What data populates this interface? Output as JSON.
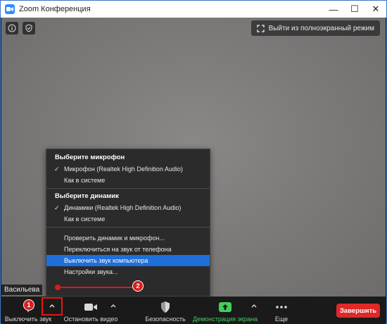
{
  "window": {
    "title": "Zoom Конференция",
    "minimize": "—",
    "maximize": "☐",
    "close": "✕"
  },
  "video": {
    "fullscreen_label": "Выйти из полноэкранный режим",
    "participant_name": "Васильева"
  },
  "audio_menu": {
    "mic_header": "Выберите микрофон",
    "mic_items": [
      {
        "label": "Микрофон (Realtek High Definition Audio)",
        "checked": true
      },
      {
        "label": "Как в системе",
        "checked": false
      }
    ],
    "speaker_header": "Выберите динамик",
    "speaker_items": [
      {
        "label": "Динамики (Realtek High Definition Audio)",
        "checked": true
      },
      {
        "label": "Как в системе",
        "checked": false
      }
    ],
    "actions": [
      "Проверить динамик и микрофон...",
      "Переключиться на звук от телефона",
      "Выключить звук компьютера",
      "Настройки звука..."
    ],
    "check_glyph": "✓"
  },
  "toolbar": {
    "mute_label": "Выключить звук",
    "video_label": "Остановить видео",
    "security_label": "Безопасность",
    "share_label": "Демонстрация экрана",
    "more_label": "Еще",
    "end_label": "Завершить"
  },
  "annotations": {
    "badge_1": "1",
    "badge_2": "2"
  },
  "colors": {
    "highlight": "#1e6fd9",
    "end_button": "#e02828",
    "share_green": "#3ecf5a",
    "annotation_red": "#e01818"
  }
}
